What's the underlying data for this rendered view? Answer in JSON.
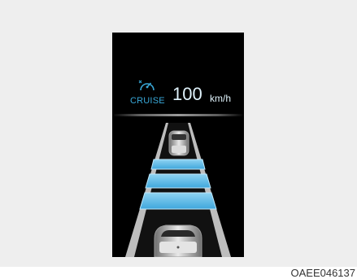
{
  "display": {
    "mode_label": "CRUISE",
    "speed_value": "100",
    "speed_unit": "km/h",
    "icon": "cruise-speedometer-icon",
    "accent_color": "#39a8d8",
    "distance_bars_shown": 3
  },
  "caption": "OAEE046137"
}
